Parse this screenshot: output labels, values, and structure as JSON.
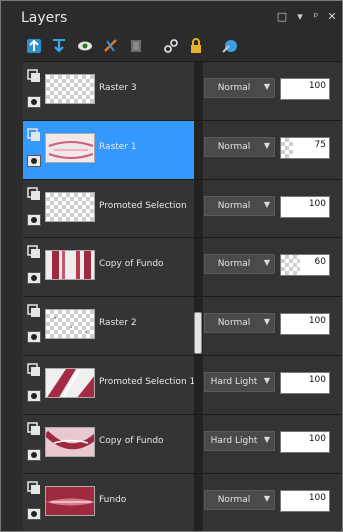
{
  "window": {
    "title": "Layers",
    "controls": [
      "□",
      "▾",
      "ᵖ",
      "✕"
    ]
  },
  "toolbar": [
    "new-raster-layer-icon",
    "new-vector-layer-icon",
    "visibility-icon",
    "edit-mask-icon",
    "layer-properties-icon",
    "link-icon",
    "lock-icon",
    "eye-dropper-icon"
  ],
  "layers": [
    {
      "name": "Raster 3",
      "blend": "Normal",
      "opacity": 100,
      "selected": false,
      "thumb": "transparent",
      "type": "raster"
    },
    {
      "name": "Raster 1",
      "blend": "Normal",
      "opacity": 75,
      "selected": true,
      "thumb": "frame",
      "type": "raster"
    },
    {
      "name": "Promoted Selection",
      "blend": "Normal",
      "opacity": 100,
      "selected": false,
      "thumb": "transparent",
      "type": "raster"
    },
    {
      "name": "Copy of Fundo",
      "blend": "Normal",
      "opacity": 60,
      "selected": false,
      "thumb": "stripes",
      "type": "raster"
    },
    {
      "name": "Raster 2",
      "blend": "Normal",
      "opacity": 100,
      "selected": false,
      "thumb": "dots",
      "type": "raster"
    },
    {
      "name": "Promoted Selection 1",
      "blend": "Hard Light",
      "opacity": 100,
      "selected": false,
      "thumb": "diagonal",
      "type": "raster"
    },
    {
      "name": "Copy of Fundo",
      "blend": "Hard Light",
      "opacity": 100,
      "selected": false,
      "thumb": "swirl",
      "type": "raster"
    },
    {
      "name": "Fundo",
      "blend": "Normal",
      "opacity": 100,
      "selected": false,
      "thumb": "red",
      "type": "raster"
    }
  ],
  "colors": {
    "accent": "#3399ff",
    "brand_red": "#b0344a"
  }
}
